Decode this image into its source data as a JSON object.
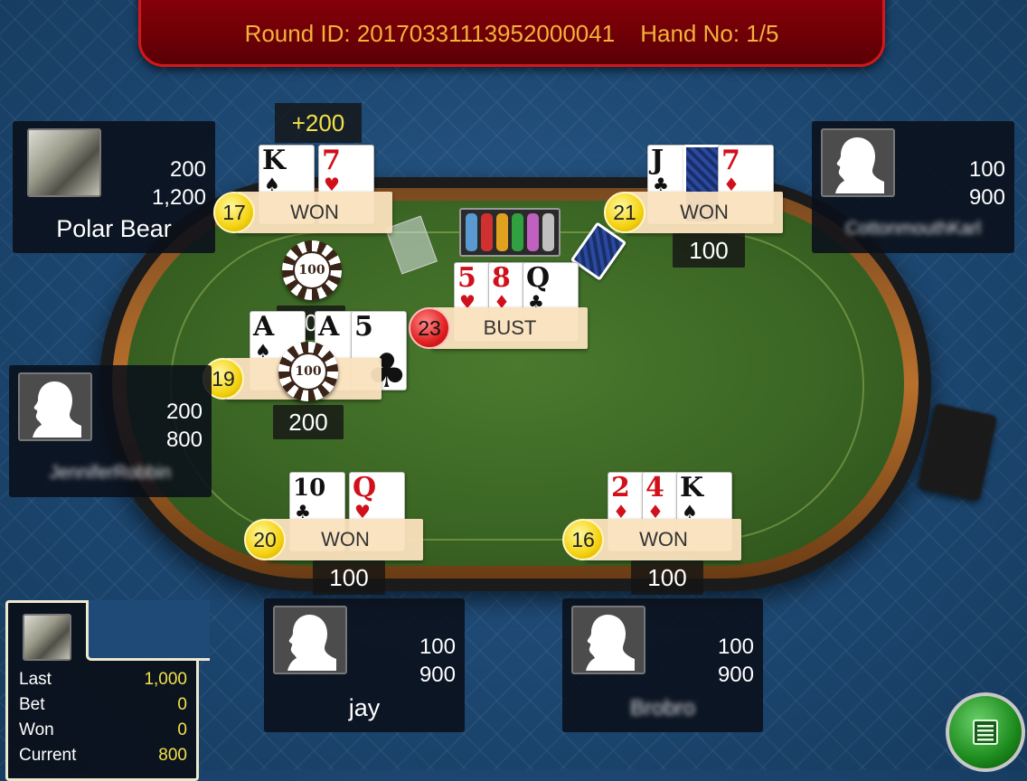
{
  "header": {
    "round_label": "Round ID: 20170331113952000041",
    "hand_label": "Hand No: 1/5"
  },
  "colors": {
    "banner": "#6e0006",
    "gold_text": "#f3b23b",
    "felt": "#3b6624",
    "win_badge": "#f4d210",
    "bust_badge": "#e02020"
  },
  "players": [
    {
      "name": "Polar Bear",
      "line1": "200",
      "line2": "1,200",
      "avatar": "photo-avatar",
      "total": "17",
      "result": "WON",
      "extra": "+200",
      "cards": [
        "K♠",
        "7♥"
      ]
    },
    {
      "name": "CottonmouthKarl",
      "line1": "100",
      "line2": "900",
      "avatar": "silhouette-icon",
      "total": "21",
      "result": "WON",
      "bet": "100",
      "cards": [
        "J♣",
        "back",
        "7♦"
      ]
    },
    {
      "name": "JenniferRobbin",
      "line1": "200",
      "line2": "800",
      "avatar": "silhouette-icon",
      "total": "19",
      "bet_top": "200",
      "bet": "200",
      "cards": [
        "A♠",
        "A",
        "5♣"
      ]
    },
    {
      "name": "jay",
      "line1": "100",
      "line2": "900",
      "avatar": "silhouette-icon",
      "total": "20",
      "result": "WON",
      "bet": "100",
      "cards": [
        "10♣",
        "Q♥"
      ]
    },
    {
      "name": "Brobro",
      "line1": "100",
      "line2": "900",
      "avatar": "silhouette-icon",
      "total": "16",
      "result": "WON",
      "bet": "100",
      "cards": [
        "2♦",
        "4♦",
        "K♠"
      ]
    }
  ],
  "dealer": {
    "total": "23",
    "result": "BUST",
    "cards": [
      "5♥",
      "8♦",
      "Q♣"
    ]
  },
  "chips": {
    "value": "100"
  },
  "info": {
    "last_label": "Last",
    "last_value": "1,000",
    "bet_label": "Bet",
    "bet_value": "0",
    "won_label": "Won",
    "won_value": "0",
    "current_label": "Current",
    "current_value": "800"
  },
  "icons": {
    "menu": "menu-list-icon",
    "shoe": "card-shoe",
    "tray": "chip-tray"
  }
}
